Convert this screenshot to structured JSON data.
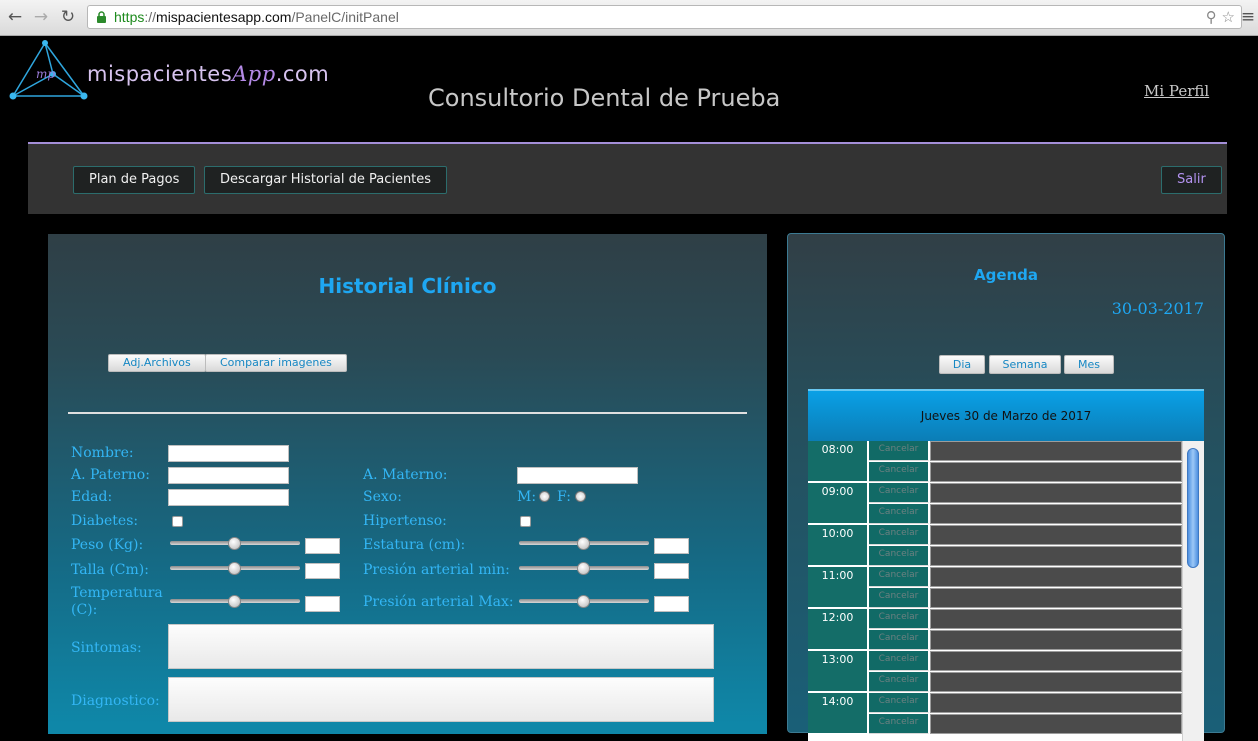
{
  "browser": {
    "url_scheme": "https",
    "url_separator": "://",
    "url_host": "mispacientesapp.com",
    "url_path": "/PanelC/initPanel",
    "back_icon": "back-arrow-icon",
    "forward_icon": "forward-arrow-icon",
    "reload_icon": "reload-icon",
    "secure_icon": "lock-icon",
    "star_icon": "bookmark-star-icon",
    "menu_icon": "menu-icon"
  },
  "header": {
    "logo_main": "mispacientes",
    "logo_app": "App",
    "logo_tld": ".com",
    "logo_monogram": "mp",
    "site_title": "Consultorio Dental de Prueba",
    "profile_link": "Mi Perfil"
  },
  "toolbar": {
    "plan_pagos": "Plan de Pagos",
    "descargar_historial": "Descargar Historial de Pacientes",
    "salir": "Salir"
  },
  "historial": {
    "title": "Historial Clínico",
    "tab_adjuntar": "Adj.Archivos",
    "tab_comparar": "Comparar imagenes",
    "labels": {
      "nombre": "Nombre:",
      "a_paterno": "A. Paterno:",
      "a_materno": "A. Materno:",
      "edad": "Edad:",
      "sexo": "Sexo:",
      "sexo_m": "M:",
      "sexo_f": "F:",
      "diabetes": "Diabetes:",
      "hipertenso": "Hipertenso:",
      "peso": "Peso (Kg):",
      "estatura": "Estatura (cm):",
      "talla": "Talla (Cm):",
      "presion_min": "Presión arterial min:",
      "temperatura_1": "Temperatura",
      "temperatura_2": "(C):",
      "presion_max": "Presión arterial Max:",
      "sintomas": "Sintomas:",
      "diagnostico": "Diagnostico:"
    },
    "sliders": {
      "peso": 0.5,
      "talla": 0.5,
      "temperatura": 0.5,
      "estatura": 0.5,
      "presion_min": 0.5,
      "presion_max": 0.5
    }
  },
  "agenda": {
    "title": "Agenda",
    "date": "30-03-2017",
    "view_dia": "Dia",
    "view_semana": "Semana",
    "view_mes": "Mes",
    "day_header": "Jueves 30 de Marzo de 2017",
    "cancel_label": "Cancelar",
    "hours": [
      "08:00",
      "09:00",
      "10:00",
      "11:00",
      "12:00",
      "13:00",
      "14:00"
    ]
  }
}
